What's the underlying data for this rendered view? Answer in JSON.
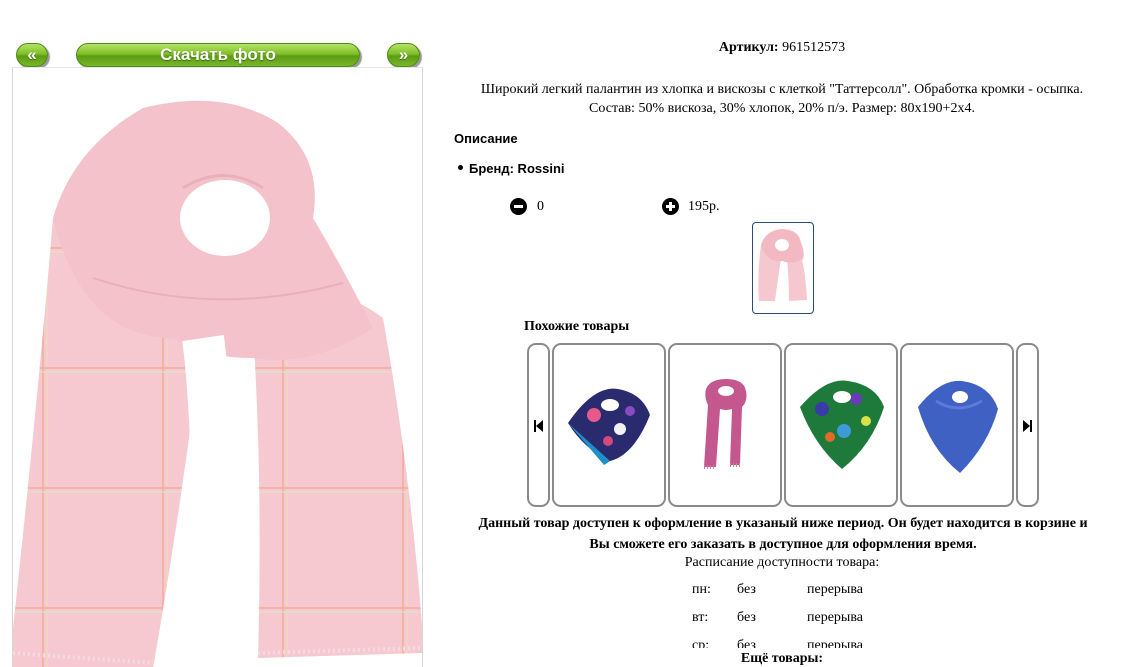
{
  "gallery": {
    "prev_label": "«",
    "next_label": "»",
    "download_label": "Скачать фото"
  },
  "product": {
    "article_label": "Артикул:",
    "article_value": "961512573",
    "description_line1": "Широкий легкий палантин из хлопка и вискозы с клеткой \"Таттерсолл\". Обработка кромки - осыпка.",
    "description_line2": "Состав: 50% вискоза, 30% хлопок, 20% п/э. Размер: 80х190+2х4.",
    "section_title": "Описание",
    "brand_line": "Бренд: Rossini",
    "quantity": "0",
    "price": "195р."
  },
  "similar": {
    "title": "Похожие товары",
    "items": [
      {
        "icon": "dark-floral-shawl-image"
      },
      {
        "icon": "pink-scarf-image"
      },
      {
        "icon": "green-floral-shawl-image"
      },
      {
        "icon": "blue-shawl-image"
      }
    ]
  },
  "availability": {
    "notice_line1": "Данный товар доступен к оформление в указаный ниже период. Он будет находится в корзине и",
    "notice_line2": "Вы сможете его заказать в доступное для оформления время.",
    "schedule_title": "Расписание доступности товара:",
    "rows": [
      {
        "day": "пн:",
        "without": "без",
        "breaks": "перерыва"
      },
      {
        "day": "вт:",
        "without": "без",
        "breaks": "перерыва"
      },
      {
        "day": "ср:",
        "without": "без",
        "breaks": "перерыва"
      }
    ]
  },
  "more_title": "Ещё товары:",
  "colors": {
    "accent_green": "#7fc026",
    "scarf_pink": "#f5c8cf",
    "card_border": "#8a8a8a"
  }
}
